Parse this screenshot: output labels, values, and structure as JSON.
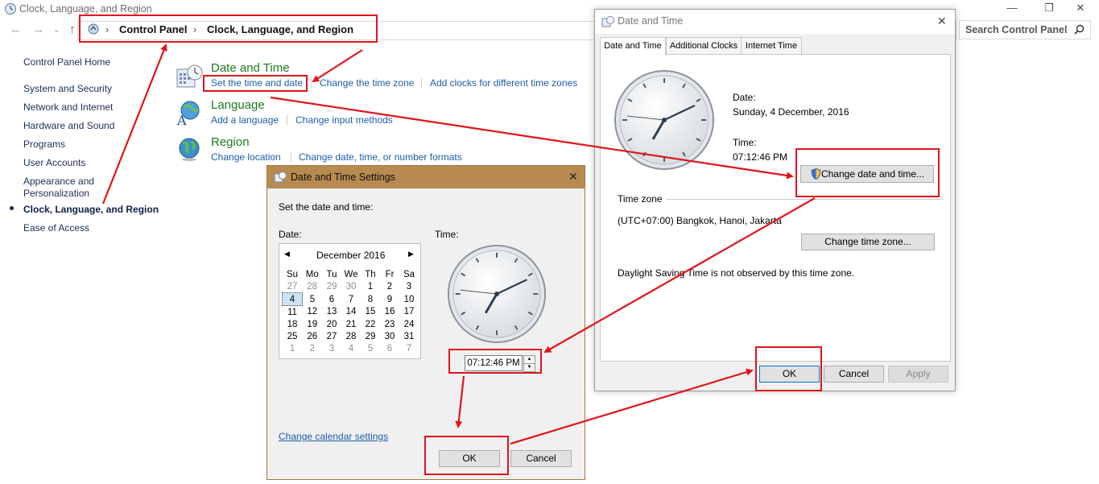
{
  "window": {
    "title": "Clock, Language, and Region",
    "controls": {
      "minimize": "—",
      "restore": "❐",
      "close": "✕"
    }
  },
  "address_bar": {
    "breadcrumbs": [
      "Control Panel",
      "Clock, Language, and Region"
    ],
    "search_placeholder": "Search Control Panel"
  },
  "sidebar": {
    "home": "Control Panel Home",
    "items": [
      "System and Security",
      "Network and Internet",
      "Hardware and Sound",
      "Programs",
      "User Accounts",
      "Appearance and",
      "Personalization",
      "Clock, Language, and Region",
      "Ease of Access"
    ]
  },
  "categories": {
    "date_time": {
      "title": "Date and Time",
      "links": [
        "Set the time and date",
        "Change the time zone",
        "Add clocks for different time zones"
      ]
    },
    "language": {
      "title": "Language",
      "links": [
        "Add a language",
        "Change input methods"
      ]
    },
    "region": {
      "title": "Region",
      "links": [
        "Change location",
        "Change date, time, or number formats"
      ]
    }
  },
  "datetime_dialog": {
    "title": "Date and Time",
    "tabs": [
      "Date and Time",
      "Additional Clocks",
      "Internet Time"
    ],
    "date_label": "Date:",
    "date_value": "Sunday, 4 December, 2016",
    "time_label": "Time:",
    "time_value": "07:12:46 PM",
    "change_button": "Change date and time...",
    "timezone_label": "Time zone",
    "timezone_value": "(UTC+07:00) Bangkok, Hanoi, Jakarta",
    "change_tz_button": "Change time zone...",
    "dst_note": "Daylight Saving Time is not observed by this time zone.",
    "buttons": {
      "ok": "OK",
      "cancel": "Cancel",
      "apply": "Apply"
    }
  },
  "settings_dialog": {
    "title": "Date and Time Settings",
    "instruction": "Set the date and time:",
    "date_label": "Date:",
    "time_label": "Time:",
    "calendar": {
      "month_label": "December 2016",
      "weekdays": [
        "Su",
        "Mo",
        "Tu",
        "We",
        "Th",
        "Fr",
        "Sa"
      ],
      "weeks": [
        [
          "27",
          "28",
          "29",
          "30",
          "1",
          "2",
          "3"
        ],
        [
          "4",
          "5",
          "6",
          "7",
          "8",
          "9",
          "10"
        ],
        [
          "11",
          "12",
          "13",
          "14",
          "15",
          "16",
          "17"
        ],
        [
          "18",
          "19",
          "20",
          "21",
          "22",
          "23",
          "24"
        ],
        [
          "25",
          "26",
          "27",
          "28",
          "29",
          "30",
          "31"
        ],
        [
          "1",
          "2",
          "3",
          "4",
          "5",
          "6",
          "7"
        ]
      ],
      "selected": "4"
    },
    "time_value": "07:12:46 PM",
    "calendar_link": "Change calendar settings",
    "buttons": {
      "ok": "OK",
      "cancel": "Cancel"
    }
  },
  "colors": {
    "annotation": "#e0141b",
    "link": "#1c5ca8",
    "category": "#1e7b1e",
    "settings_titlebar": "#b88a4f"
  }
}
